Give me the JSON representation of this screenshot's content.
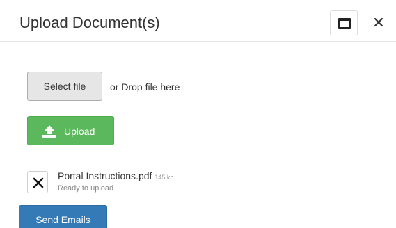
{
  "dialog": {
    "title": "Upload Document(s)",
    "maximize_icon": "window-maximize-icon",
    "close_icon": "close-icon"
  },
  "upload": {
    "select_file_label": "Select file",
    "drop_text": "or Drop file here",
    "upload_label": "Upload",
    "upload_icon": "upload-icon"
  },
  "files": [
    {
      "name": "Portal Instructions.pdf",
      "size": "145 kb",
      "status": "Ready to upload",
      "remove_icon": "close-icon"
    }
  ],
  "actions": {
    "send_emails_label": "Send Emails"
  },
  "colors": {
    "upload_button": "#5cb85c",
    "send_button": "#337ab7",
    "select_button": "#e6e6e6"
  }
}
